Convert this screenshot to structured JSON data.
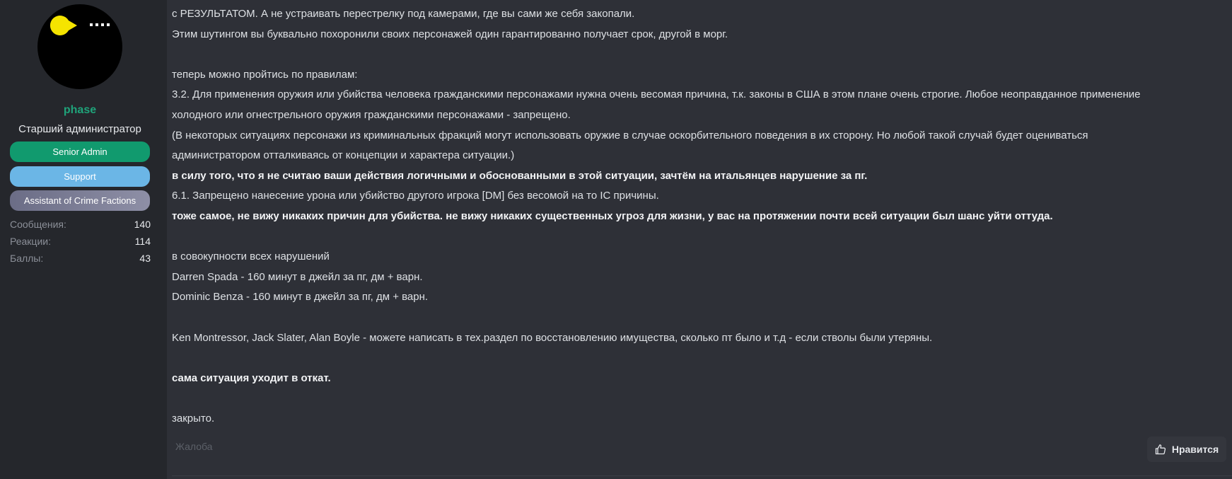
{
  "author": {
    "username": "phase",
    "title": "Старший администратор",
    "banners": [
      "Senior Admin",
      "Support",
      "Assistant of Crime Factions"
    ],
    "stats": [
      {
        "label": "Сообщения:",
        "value": "140"
      },
      {
        "label": "Реакции:",
        "value": "114"
      },
      {
        "label": "Баллы:",
        "value": "43"
      }
    ]
  },
  "post": {
    "lines": [
      {
        "text": "с РЕЗУЛЬТАТОМ. А не устраивать перестрелку под камерами, где вы сами же себя закопали.",
        "bold": false
      },
      {
        "text": "Этим шутингом вы буквально похоронили своих персонажей один гарантированно получает срок, другой в морг.",
        "bold": false
      },
      {
        "text": "",
        "bold": false
      },
      {
        "text": "теперь можно пройтись по правилам:",
        "bold": false
      },
      {
        "text": "3.2. Для применения оружия или убийства человека гражданскими персонажами нужна очень весомая причина, т.к. законы в США в этом плане очень строгие. Любое неоправданное применение",
        "bold": false
      },
      {
        "text": "холодного или огнестрельного оружия гражданскими персонажами - запрещено.",
        "bold": false
      },
      {
        "text": "(В некоторых ситуациях персонажи из криминальных фракций могут использовать оружие в случае оскорбительного поведения в их сторону. Но любой такой случай будет оцениваться",
        "bold": false
      },
      {
        "text": "администратором отталкиваясь от концепции и характера ситуации.)",
        "bold": false
      },
      {
        "text": "в силу того, что я не считаю ваши действия логичными и обоснованными в этой ситуации, зачтём на итальянцев нарушение за пг.",
        "bold": true
      },
      {
        "text": "6.1. Запрещено нанесение урона или убийство другого игрока [DM] без весомой на то IC причины.",
        "bold": false
      },
      {
        "text": "тоже самое, не вижу никаких причин для убийства. не вижу никаких существенных угроз для жизни, у вас на протяжении почти всей ситуации был шанс уйти оттуда.",
        "bold": true
      },
      {
        "text": "",
        "bold": false
      },
      {
        "text": "в совокупности всех нарушений",
        "bold": false
      },
      {
        "text": "Darren Spada - 160 минут в джейл за пг, дм + варн.",
        "bold": false
      },
      {
        "text": "Dominic Benza - 160 минут в джейл за пг, дм + варн.",
        "bold": false
      },
      {
        "text": "",
        "bold": false
      },
      {
        "text": "Ken Montressor, Jack Slater, Alan Boyle - можете написать в тех.раздел по восстановлению имущества, сколько пт было и т.д - если стволы были утеряны.",
        "bold": false
      },
      {
        "text": "",
        "bold": false
      },
      {
        "text": "сама ситуация уходит в откат.",
        "bold": true
      },
      {
        "text": "",
        "bold": false
      },
      {
        "text": "закрыто.",
        "bold": false
      }
    ]
  },
  "actions": {
    "report_label": "Жалоба",
    "like_label": "Нравится"
  },
  "colors": {
    "username": "#1fa37a",
    "senior_admin": "#119a6e",
    "support": "#6bb6e6",
    "crime_factions": "#7d7f97",
    "avatar_pacman": "#f5e400"
  },
  "icons": {
    "avatar": "pacman-icon",
    "like": "thumbs-up-icon"
  }
}
